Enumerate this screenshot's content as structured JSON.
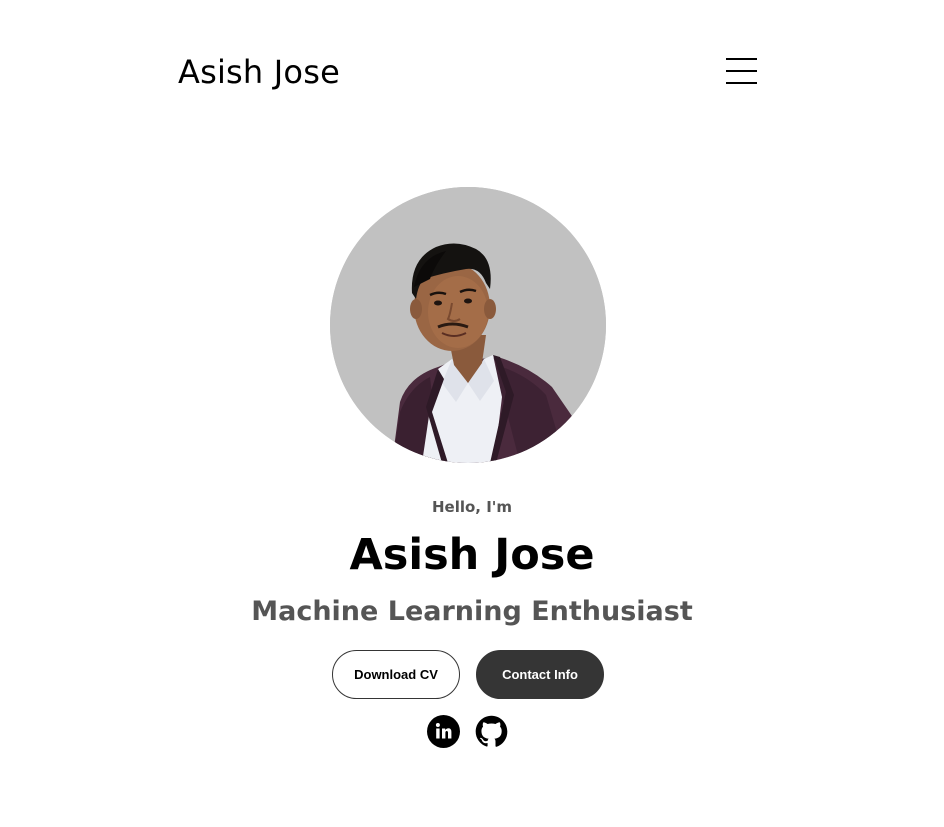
{
  "nav": {
    "logo": "Asish Jose",
    "menu_icon": "hamburger-menu-icon"
  },
  "profile": {
    "image_alt": "Profile picture"
  },
  "hero": {
    "greeting": "Hello, I'm",
    "name": "Asish Jose",
    "title": "Machine Learning Enthusiast"
  },
  "buttons": {
    "download_cv": "Download CV",
    "contact_info": "Contact Info"
  },
  "socials": [
    {
      "name": "linkedin",
      "icon": "linkedin-icon"
    },
    {
      "name": "github",
      "icon": "github-icon"
    }
  ],
  "colors": {
    "background": "#ffffff",
    "text_primary": "#000000",
    "text_secondary": "#555555",
    "button_dark": "#353535",
    "photo_backdrop": "#c1c1c1"
  }
}
